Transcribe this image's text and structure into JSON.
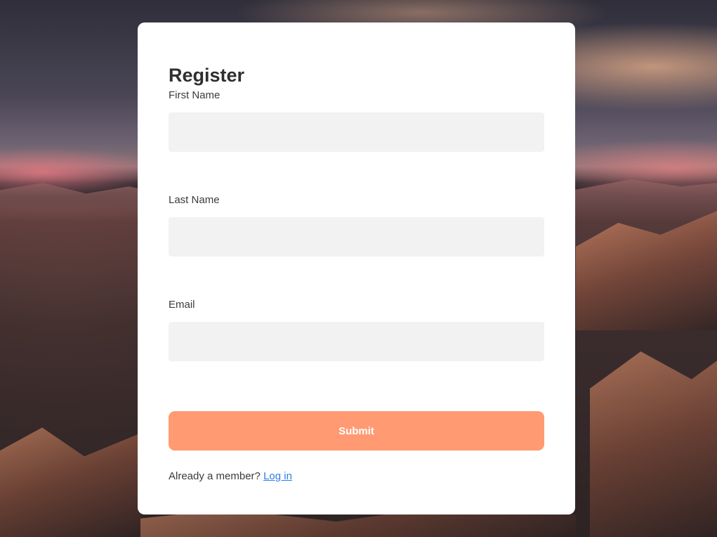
{
  "form": {
    "title": "Register",
    "fields": [
      {
        "label": "First Name",
        "value": "",
        "placeholder": ""
      },
      {
        "label": "Last Name",
        "value": "",
        "placeholder": ""
      },
      {
        "label": "Email",
        "value": "",
        "placeholder": ""
      }
    ],
    "submit_label": "Submit",
    "footer_text": "Already a member?",
    "login_link": "Log in"
  },
  "colors": {
    "accent": "#ff9a72",
    "link": "#2f7ee6",
    "input_bg": "#f2f2f2",
    "card_bg": "#ffffff"
  }
}
